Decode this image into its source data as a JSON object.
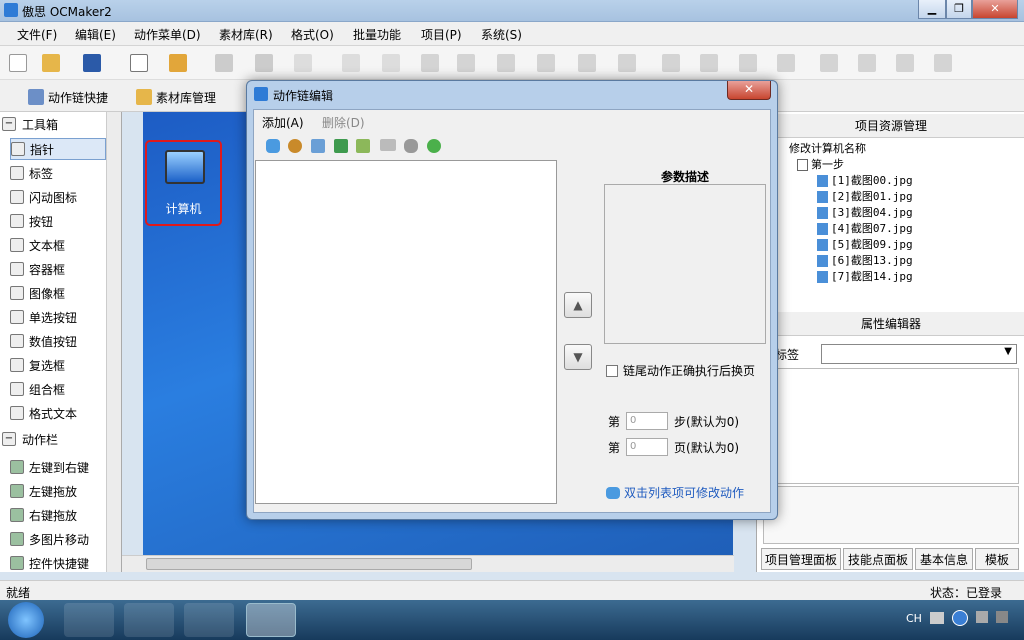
{
  "window": {
    "title": "傲思 OCMaker2",
    "minimize": "▁",
    "restore": "❐",
    "close": "✕"
  },
  "menu": [
    "文件(F)",
    "编辑(E)",
    "动作菜单(D)",
    "素材库(R)",
    "格式(O)",
    "批量功能",
    "项目(P)",
    "系统(S)"
  ],
  "toolbar2": {
    "action_chain": "动作链快捷",
    "asset_manager": "素材库管理"
  },
  "toolbox": {
    "section_tools": "工具箱",
    "tools": [
      "指针",
      "标签",
      "闪动图标",
      "按钮",
      "文本框",
      "容器框",
      "图像框",
      "单选按钮",
      "数值按钮",
      "复选框",
      "组合框",
      "格式文本"
    ],
    "tool_icons": [
      "pointer-icon",
      "label-icon",
      "flash-icon",
      "button-icon",
      "textbox-icon",
      "container-icon",
      "image-icon",
      "radio-icon",
      "numeric-icon",
      "checkbox-icon",
      "combo-icon",
      "richtext-icon"
    ],
    "section_actions": "动作栏",
    "actions": [
      "左键到右键",
      "左键拖放",
      "右键拖放",
      "多图片移动",
      "控件快捷键"
    ]
  },
  "canvas": {
    "desktop_icon_label": "计算机"
  },
  "project_panel": {
    "title": "项目资源管理",
    "root": "修改计算机名称",
    "step": "第一步",
    "files": [
      "[1]截图00.jpg",
      "[2]截图01.jpg",
      "[3]截图04.jpg",
      "[4]截图07.jpg",
      "[5]截图09.jpg",
      "[6]截图13.jpg",
      "[7]截图14.jpg"
    ]
  },
  "property_panel": {
    "title": "属性编辑器",
    "tag_label": "有标签"
  },
  "right_tabs": [
    "项目管理面板",
    "技能点面板",
    "基本信息",
    "模板"
  ],
  "dialog": {
    "title": "动作链编辑",
    "menu_add": "添加(A)",
    "menu_delete": "删除(D)",
    "up_arrow": "▲",
    "down_arrow": "▼",
    "param_title": "参数描述",
    "checkbox_label": "链尾动作正确执行后换页",
    "step_prefix": "第",
    "step_value": "0",
    "step_suffix": "步(默认为0)",
    "page_prefix": "第",
    "page_value": "0",
    "page_suffix": "页(默认为0)",
    "hint": "双击列表项可修改动作",
    "close": "✕"
  },
  "status": {
    "left": "就绪",
    "right": "状态：已登录"
  },
  "tray": {
    "lang": "CH"
  },
  "colors": {
    "accent": "#1f5bbf",
    "highlight": "#e0191b",
    "desktop": "#2a7ee0"
  }
}
